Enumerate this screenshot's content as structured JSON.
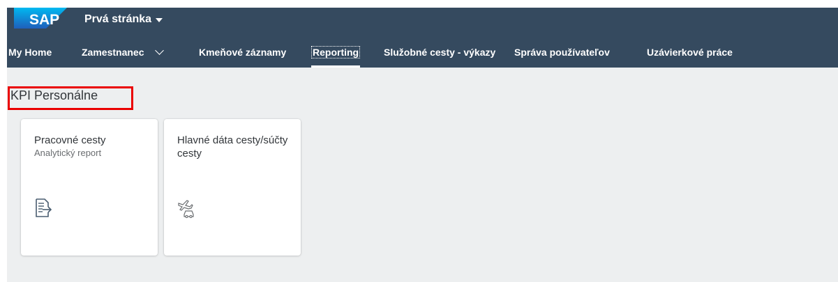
{
  "header": {
    "logo_text": "SAP",
    "page_title": "Prvá stránka",
    "background": "#354a5f"
  },
  "nav": {
    "items": [
      {
        "label": "My Home"
      },
      {
        "label": "Zamestnanec"
      },
      {
        "label": "Kmeňové záznamy"
      },
      {
        "label": "Reporting",
        "selected": true
      },
      {
        "label": "Služobné cesty - výkazy"
      },
      {
        "label": "Správa používateľov"
      },
      {
        "label": "Uzávierkové práce"
      }
    ]
  },
  "section": {
    "title": "KPI Personálne",
    "highlight_color": "#ea0000"
  },
  "tiles": [
    {
      "title": "Pracovné cesty",
      "subtitle": "Analytický report",
      "icon": "report-list-icon"
    },
    {
      "title": "Hlavné dáta cesty/súčty cesty",
      "subtitle": "",
      "icon": "travel-plane-car-icon"
    }
  ],
  "colors": {
    "content_background": "#edeff0",
    "tile_background": "#ffffff",
    "icon_color": "#6a6d70"
  }
}
